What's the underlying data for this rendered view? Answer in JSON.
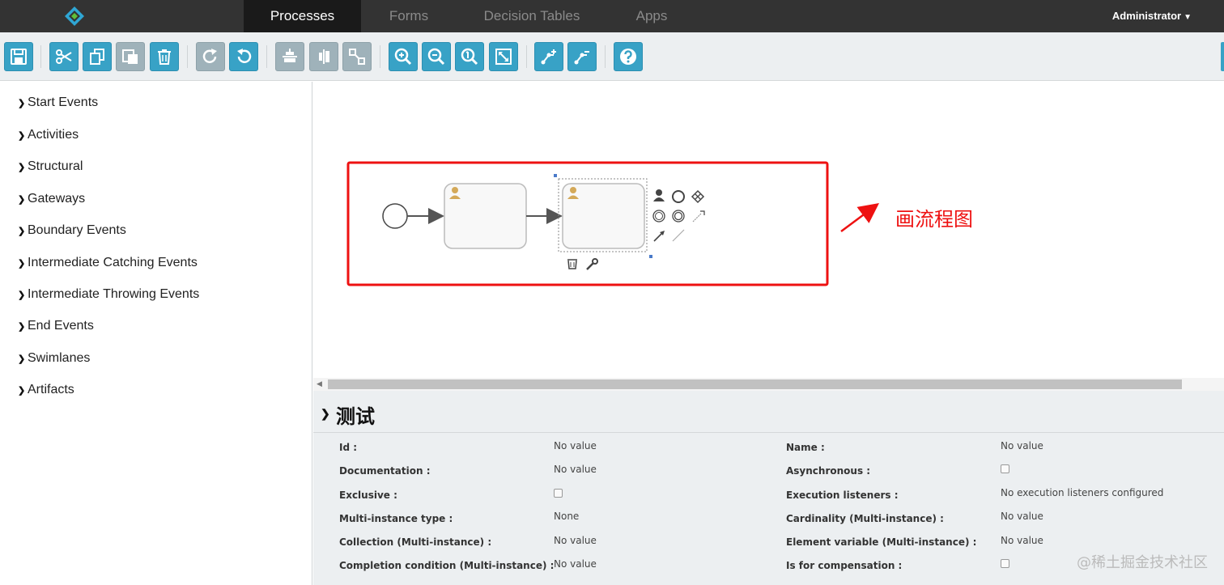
{
  "nav": {
    "tabs": [
      {
        "label": "Processes",
        "active": true
      },
      {
        "label": "Forms",
        "active": false
      },
      {
        "label": "Decision Tables",
        "active": false
      },
      {
        "label": "Apps",
        "active": false
      }
    ],
    "user": "Administrator"
  },
  "toolbar": {
    "buttons": [
      {
        "icon": "save-icon",
        "enabled": true
      },
      {
        "icon": "cut-icon",
        "enabled": true
      },
      {
        "icon": "copy-icon",
        "enabled": true
      },
      {
        "icon": "paste-icon",
        "enabled": false
      },
      {
        "icon": "delete-icon",
        "enabled": true
      },
      {
        "icon": "redo-icon",
        "enabled": false
      },
      {
        "icon": "undo-icon",
        "enabled": true
      },
      {
        "icon": "align-vertical-icon",
        "enabled": false
      },
      {
        "icon": "align-horizontal-icon",
        "enabled": false
      },
      {
        "icon": "same-size-icon",
        "enabled": false
      },
      {
        "icon": "zoom-in-icon",
        "enabled": true
      },
      {
        "icon": "zoom-out-icon",
        "enabled": true
      },
      {
        "icon": "zoom-actual-icon",
        "enabled": true
      },
      {
        "icon": "zoom-fit-icon",
        "enabled": true
      },
      {
        "icon": "add-bendpoint-icon",
        "enabled": true
      },
      {
        "icon": "remove-bendpoint-icon",
        "enabled": true
      },
      {
        "icon": "help-icon",
        "enabled": true
      }
    ]
  },
  "palette": {
    "groups": [
      "Start Events",
      "Activities",
      "Structural",
      "Gateways",
      "Boundary Events",
      "Intermediate Catching Events",
      "Intermediate Throwing Events",
      "End Events",
      "Swimlanes",
      "Artifacts"
    ]
  },
  "canvas": {
    "annotation": "画流程图",
    "colors": {
      "highlight": "#ee1111",
      "task_fill": "#f8f8f8",
      "task_stroke": "#bbbbbb"
    }
  },
  "properties": {
    "title": "测试",
    "left": [
      {
        "label": "Id :",
        "value": "No value"
      },
      {
        "label": "Documentation :",
        "value": "No value"
      },
      {
        "label": "Exclusive :",
        "value": "",
        "checkbox": true
      },
      {
        "label": "Multi-instance type :",
        "value": "None"
      },
      {
        "label": "Collection (Multi-instance) :",
        "value": "No value"
      },
      {
        "label": "Completion condition (Multi-instance) :",
        "value": "No value"
      }
    ],
    "right": [
      {
        "label": "Name :",
        "value": "No value"
      },
      {
        "label": "Asynchronous :",
        "value": "",
        "checkbox": true
      },
      {
        "label": "Execution listeners :",
        "value": "No execution listeners configured"
      },
      {
        "label": "Cardinality (Multi-instance) :",
        "value": "No value"
      },
      {
        "label": "Element variable (Multi-instance) :",
        "value": "No value"
      },
      {
        "label": "Is for compensation :",
        "value": "",
        "checkbox": true
      }
    ]
  },
  "watermark": "@稀土掘金技术社区"
}
